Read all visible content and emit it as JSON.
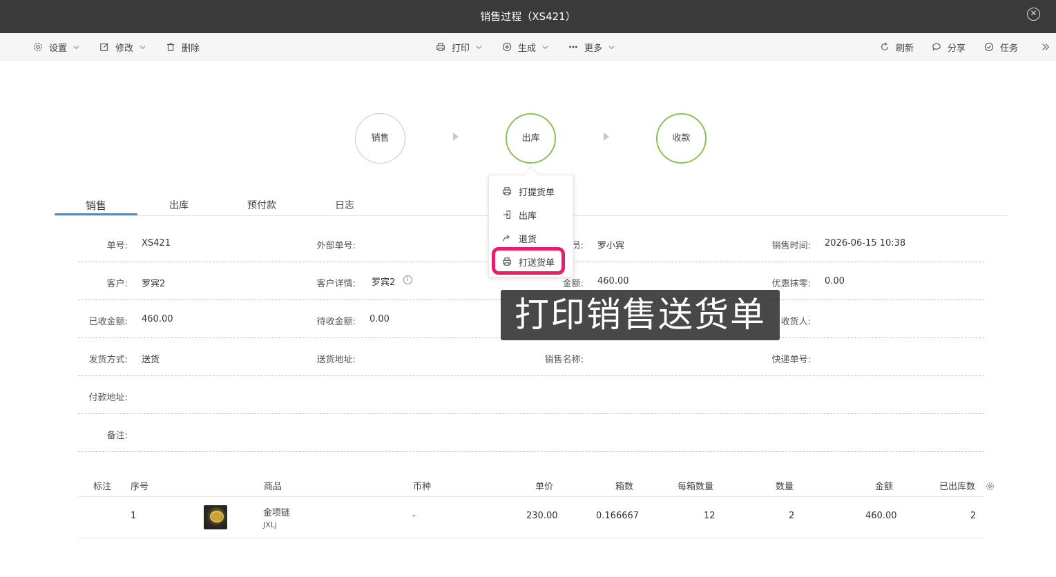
{
  "window": {
    "title": "销售过程（XS421）"
  },
  "toolbar": {
    "settings": "设置",
    "edit": "修改",
    "delete": "删除",
    "print": "打印",
    "generate": "生成",
    "more": "更多",
    "refresh": "刷新",
    "share": "分享",
    "task": "任务"
  },
  "flow": {
    "sale": "销售",
    "outbound": "出库",
    "payment": "收款"
  },
  "tabs": [
    "销售",
    "出库",
    "预付款",
    "日志"
  ],
  "dropdown": {
    "items": [
      "打提货单",
      "出库",
      "退货",
      "打送货单"
    ],
    "highlighted_index": 3
  },
  "info": {
    "order_no_label": "单号:",
    "order_no": "XS421",
    "external_no_label": "外部单号:",
    "external_no": "",
    "salesperson_label": "员:",
    "salesperson": "罗小宾",
    "sale_time_label": "销售时间:",
    "sale_time": "2026-06-15 10:38",
    "customer_label": "客户:",
    "customer": "罗宾2",
    "customer_detail_label": "客户详情:",
    "customer_detail": "罗宾2",
    "amount_label": "金额:",
    "amount": "460.00",
    "discount_label": "优惠抹零:",
    "discount": "0.00",
    "received_label": "已收金额:",
    "received": "460.00",
    "pending_label": "待收金额:",
    "pending": "0.00",
    "receiver_label": "收货人:",
    "receiver": "",
    "ship_method_label": "发货方式:",
    "ship_method": "送货",
    "ship_address_label": "送货地址:",
    "ship_address": "",
    "sale_name_label": "销售名称:",
    "sale_name": "",
    "express_no_label": "快递单号:",
    "express_no": "",
    "pay_address_label": "付款地址:",
    "pay_address": "",
    "remark_label": "备注:",
    "remark": ""
  },
  "table": {
    "headers": [
      "标注",
      "序号",
      "商品",
      "币种",
      "单价",
      "箱数",
      "每箱数量",
      "数量",
      "金额",
      "已出库数"
    ],
    "rows": [
      {
        "mark": "",
        "seq": "1",
        "product": "金项链",
        "product_code": "JXLj",
        "currency": "-",
        "unit_price": "230.00",
        "boxes": "0.166667",
        "per_box": "12",
        "qty": "2",
        "amount": "460.00",
        "shipped": "2"
      }
    ]
  },
  "caption": "打印销售送货单",
  "colors": {
    "tab_active": "#3e8ede",
    "node_done": "#8cc152",
    "highlight": "#ec1b6c",
    "titlebar": "#3a3a3a"
  }
}
